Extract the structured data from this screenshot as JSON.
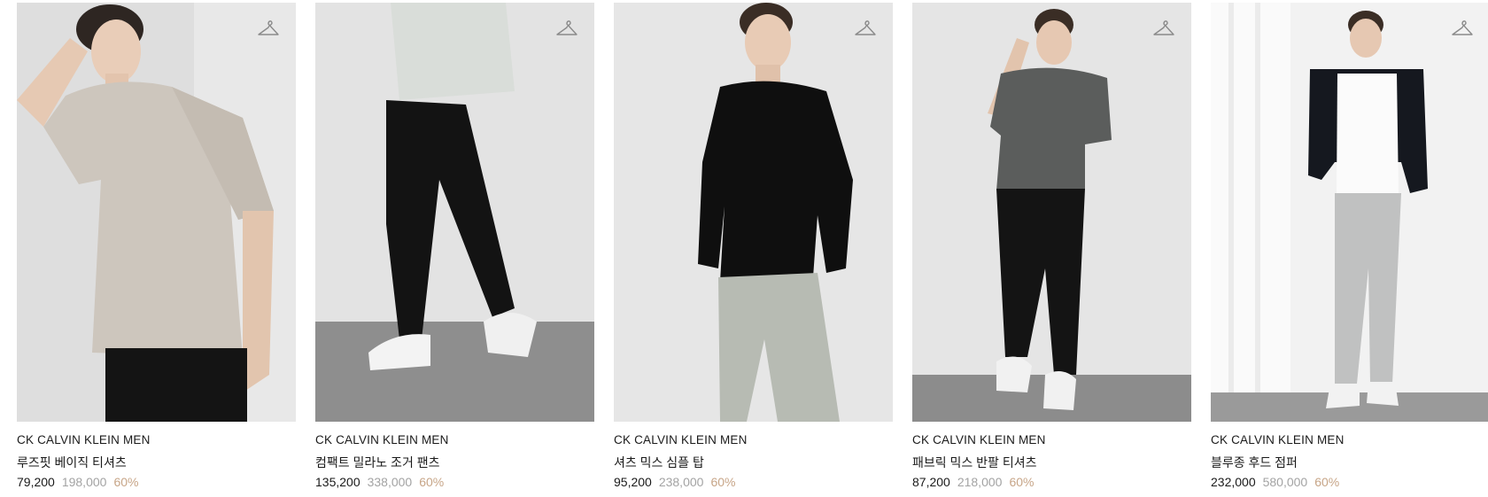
{
  "products": [
    {
      "brand": "CK CALVIN KLEIN MEN",
      "name": "루즈핏 베이직 티셔츠",
      "price": "79,200",
      "original_price": "198,000",
      "discount": "60%"
    },
    {
      "brand": "CK CALVIN KLEIN MEN",
      "name": "컴팩트 밀라노 조거 팬츠",
      "price": "135,200",
      "original_price": "338,000",
      "discount": "60%"
    },
    {
      "brand": "CK CALVIN KLEIN MEN",
      "name": "셔츠 믹스 심플 탑",
      "price": "95,200",
      "original_price": "238,000",
      "discount": "60%"
    },
    {
      "brand": "CK CALVIN KLEIN MEN",
      "name": "패브릭 믹스 반팔 티셔츠",
      "price": "87,200",
      "original_price": "218,000",
      "discount": "60%"
    },
    {
      "brand": "CK CALVIN KLEIN MEN",
      "name": "블루종 후드 점퍼",
      "price": "232,000",
      "original_price": "580,000",
      "discount": "60%"
    }
  ],
  "icons": {
    "wishlist": "hanger-icon"
  },
  "colors": {
    "discount": "#c7a587",
    "original_price": "#a3a3a3",
    "text": "#1a1a1a"
  }
}
